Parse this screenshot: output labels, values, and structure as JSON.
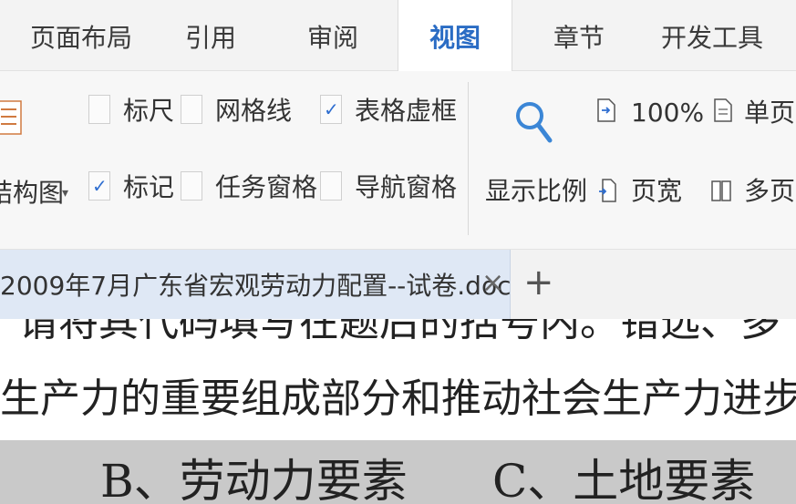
{
  "tabs": [
    {
      "label": "页面布局",
      "active": false
    },
    {
      "label": "引用",
      "active": false
    },
    {
      "label": "审阅",
      "active": false
    },
    {
      "label": "视图",
      "active": true
    },
    {
      "label": "章节",
      "active": false
    },
    {
      "label": "开发工具",
      "active": false
    }
  ],
  "ribbon": {
    "outline_label": "结构图",
    "checkboxes": {
      "ruler": {
        "label": "标尺",
        "checked": false
      },
      "gridlines": {
        "label": "网格线",
        "checked": false
      },
      "table_gridlines": {
        "label": "表格虚框",
        "checked": true
      },
      "marks": {
        "label": "标记",
        "checked": true
      },
      "task_pane": {
        "label": "任务窗格",
        "checked": false
      },
      "nav_pane": {
        "label": "导航窗格",
        "checked": false
      }
    },
    "zoom_label": "显示比例",
    "zoom_100": "100%",
    "page_width": "页宽",
    "single_page": "单页",
    "multi_page": "多页"
  },
  "document_tab": {
    "title": "2009年7月广东省宏观劳动力配置--试卷.doc",
    "close": "×",
    "new_tab": "+"
  },
  "document": {
    "line1": "请将其代码填写在题后的括号内。错选、多",
    "line2": "生产力的重要组成部分和推动社会生产力进步",
    "option_b": "B、劳动力要素",
    "option_c": "C、土地要素"
  },
  "colors": {
    "active_tab": "#2a6cc4",
    "check": "#2f6ed0",
    "doc_tab_bg": "#dfe8f5"
  }
}
